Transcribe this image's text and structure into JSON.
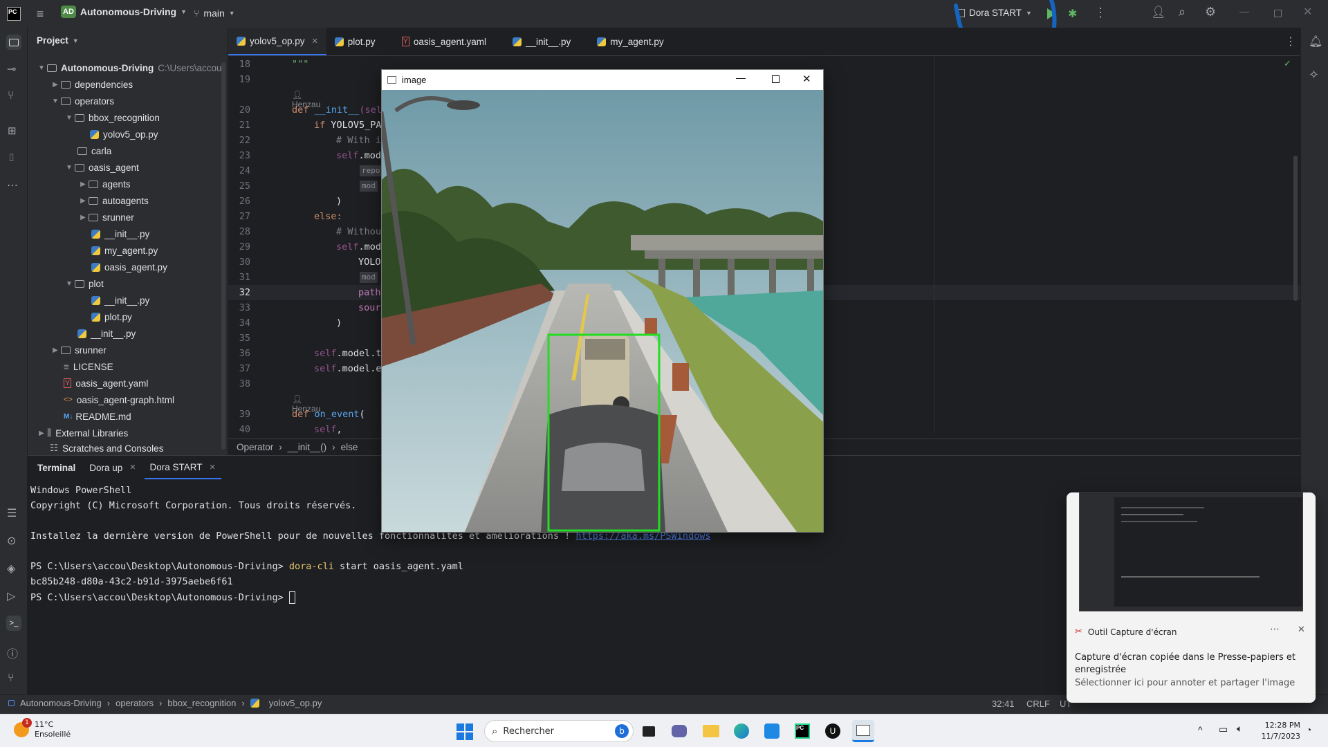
{
  "topbar": {
    "project_badge": "AD",
    "project_name": "Autonomous-Driving",
    "branch": "main",
    "run_config": "Dora START"
  },
  "project_panel": {
    "title": "Project",
    "root": "Autonomous-Driving",
    "root_path": "C:\\Users\\accou",
    "items": [
      {
        "label": "dependencies"
      },
      {
        "label": "operators"
      },
      {
        "label": "bbox_recognition"
      },
      {
        "label": "yolov5_op.py"
      },
      {
        "label": "carla"
      },
      {
        "label": "oasis_agent"
      },
      {
        "label": "agents"
      },
      {
        "label": "autoagents"
      },
      {
        "label": "srunner"
      },
      {
        "label": "__init__.py"
      },
      {
        "label": "my_agent.py"
      },
      {
        "label": "oasis_agent.py"
      },
      {
        "label": "plot"
      },
      {
        "label": "__init__.py"
      },
      {
        "label": "plot.py"
      },
      {
        "label": "__init__.py"
      },
      {
        "label": "srunner"
      },
      {
        "label": "LICENSE"
      },
      {
        "label": "oasis_agent.yaml"
      },
      {
        "label": "oasis_agent-graph.html"
      },
      {
        "label": "README.md"
      },
      {
        "label": "External Libraries"
      },
      {
        "label": "Scratches and Consoles"
      }
    ]
  },
  "tabs": [
    {
      "label": "yolov5_op.py"
    },
    {
      "label": "plot.py"
    },
    {
      "label": "oasis_agent.yaml"
    },
    {
      "label": "__init__.py"
    },
    {
      "label": "my_agent.py"
    }
  ],
  "code": {
    "author_hint_1": "Henzau",
    "author_hint_2": "Henzau",
    "line_numbers": [
      "18",
      "19",
      "20",
      "21",
      "22",
      "23",
      "24",
      "25",
      "26",
      "27",
      "28",
      "29",
      "30",
      "31",
      "32",
      "33",
      "34",
      "35",
      "36",
      "37",
      "38",
      "39",
      "40"
    ],
    "lines": {
      "l18": "\"\"\"",
      "l20a": "def ",
      "l20b": "__init__",
      "l20c": "(sel",
      "l21a": "if ",
      "l21b": "YOLOV5_PA",
      "l22": "# With i",
      "l23a": "self",
      "l23b": ".mod",
      "l24": "repo",
      "l25": "mod",
      "l26": ")",
      "l27": "else:",
      "l28": "# Withou",
      "l29a": "self",
      "l29b": ".mod",
      "l30": "YOLO",
      "l31": "mod",
      "l32": "path",
      "l33": "sour",
      "l34": ")",
      "l36a": "self",
      "l36b": ".model.t",
      "l37a": "self",
      "l37b": ".model.e",
      "l39a": "def ",
      "l39b": "on_event",
      "l39c": "(",
      "l40a": "self",
      "l40b": ","
    },
    "breadcrumb": [
      "Operator",
      "__init__()",
      "else"
    ]
  },
  "image_window": {
    "title": "image"
  },
  "terminal": {
    "tabs": [
      {
        "label": "Terminal"
      },
      {
        "label": "Dora up"
      },
      {
        "label": "Dora START"
      }
    ],
    "lines": {
      "l1": "Windows PowerShell",
      "l2": "Copyright (C) Microsoft Corporation. Tous droits réservés.",
      "l3a": "Installez la dernière version de PowerShell pour de nouvelles fonctionnalités et améliorations ! ",
      "l3b": "https://aka.ms/PSWindows",
      "l4a": "PS C:\\Users\\accou\\Desktop\\Autonomous-Driving> ",
      "l4b": "dora-cli",
      "l4c": " start oasis_agent.yaml",
      "l5": "bc85b248-d80a-43c2-b91d-3975aebe6f61",
      "l6": "PS C:\\Users\\accou\\Desktop\\Autonomous-Driving> "
    }
  },
  "statusbar": {
    "crumbs": [
      "Autonomous-Driving",
      "operators",
      "bbox_recognition",
      "yolov5_op.py"
    ],
    "position": "32:41",
    "line_sep": "CRLF",
    "encoding": "UT"
  },
  "toast": {
    "app": "Outil Capture d'écran",
    "title": "Capture d'écran copiée dans le Presse-papiers et enregistrée",
    "subtitle": "Sélectionner ici pour annoter et partager l'image"
  },
  "taskbar": {
    "weather_temp": "11°C",
    "weather_desc": "Ensoleillé",
    "weather_badge": "1",
    "search_placeholder": "Rechercher",
    "time": "12:28 PM",
    "date": "11/7/2023"
  },
  "colors": {
    "accent": "#3574f0",
    "annotation": "#1565c0",
    "detection_box": "#22dd22"
  }
}
